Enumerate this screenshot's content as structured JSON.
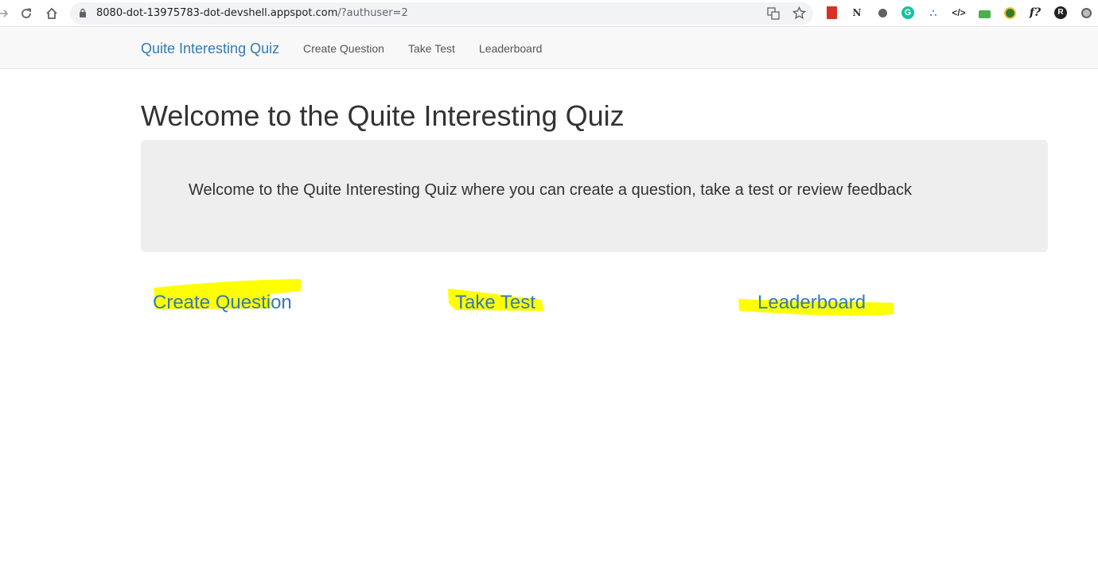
{
  "browser": {
    "url_host": "8080-dot-13975783-dot-devshell.appspot.com",
    "url_path": "/?authuser=2"
  },
  "navbar": {
    "brand": "Quite Interesting Quiz",
    "links": [
      "Create Question",
      "Take Test",
      "Leaderboard"
    ]
  },
  "page": {
    "title": "Welcome to the Quite Interesting Quiz",
    "jumbotron_text": "Welcome to the Quite Interesting Quiz where you can create a question, take a test or review feedback"
  },
  "actions": {
    "create": "Create Question",
    "test": "Take Test",
    "leaderboard": "Leaderboard"
  },
  "colors": {
    "link": "#337ab7",
    "highlight": "#ffff00"
  }
}
